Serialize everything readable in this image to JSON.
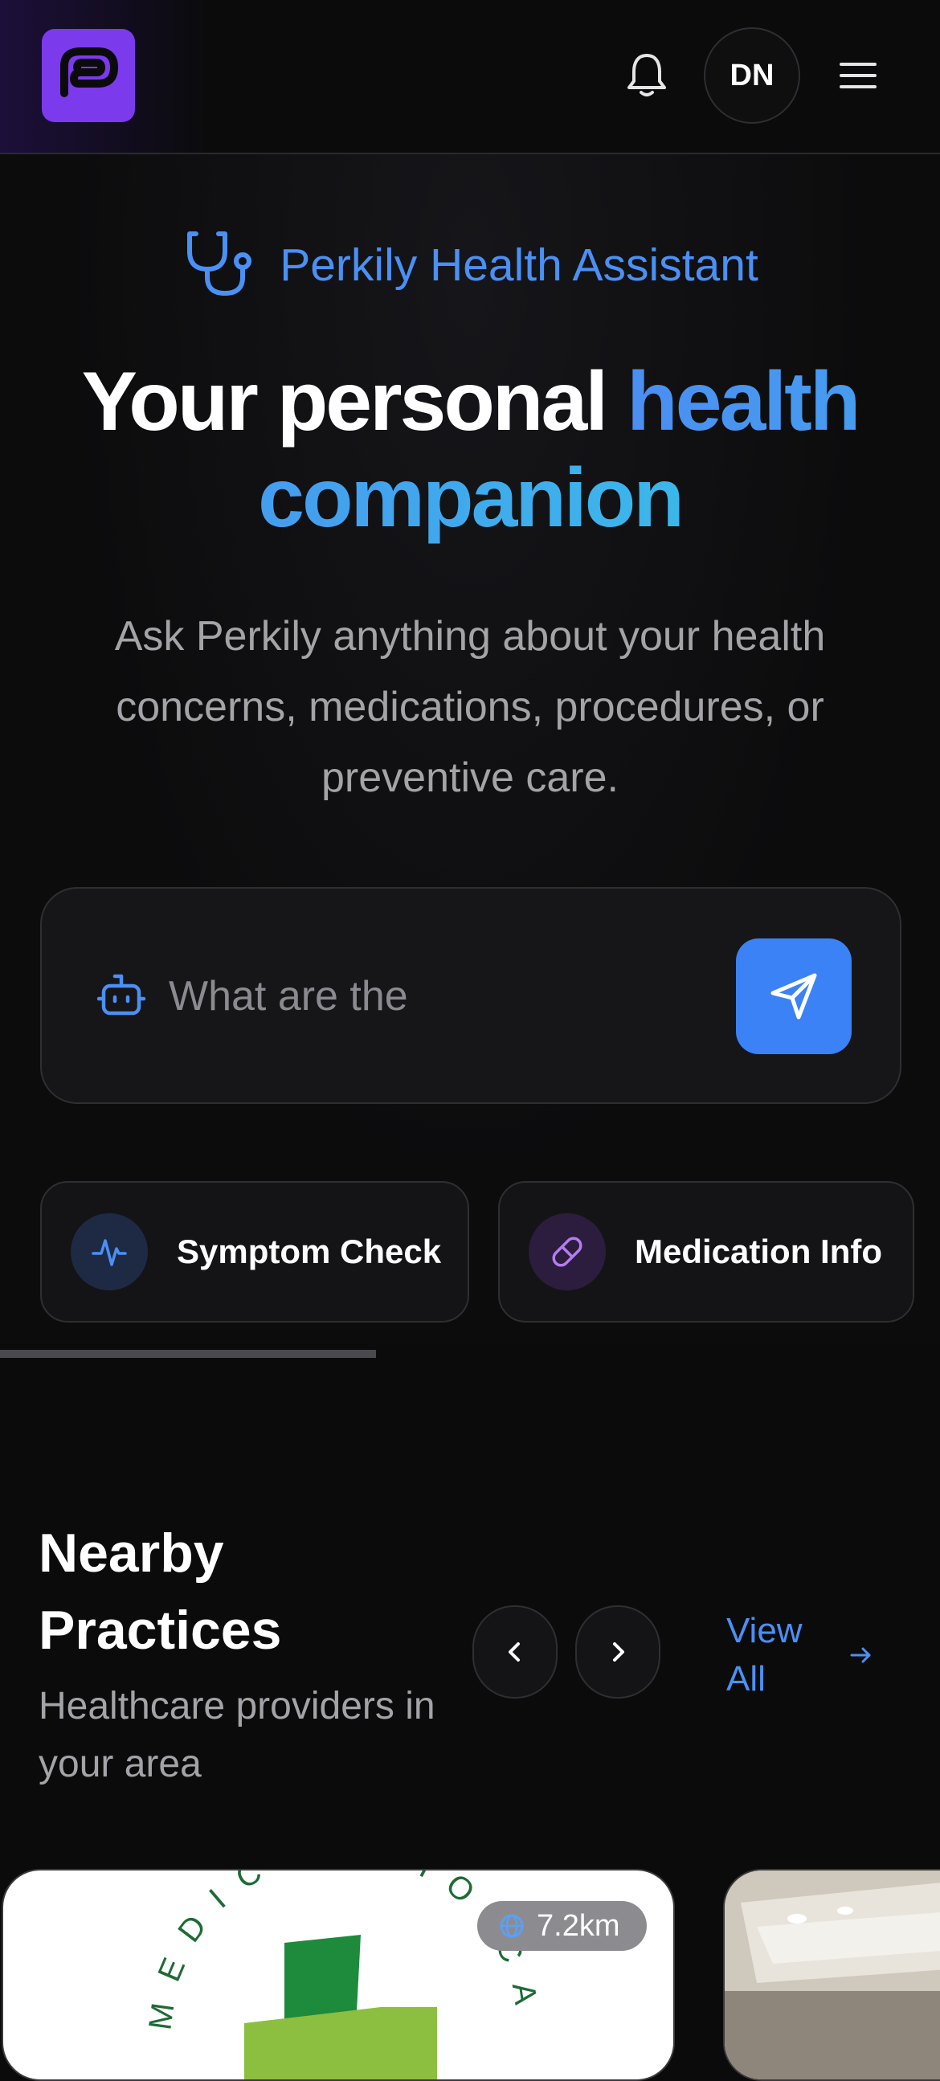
{
  "header": {
    "logo_icon": "perkily-logo-icon",
    "notification_icon": "bell-icon",
    "avatar_initials": "DN",
    "menu_icon": "hamburger-menu-icon"
  },
  "hero": {
    "assistant_icon": "stethoscope-icon",
    "assistant_label": "Perkily Health Assistant",
    "headline_plain": "Your personal ",
    "headline_accent": "health companion",
    "subtitle": "Ask Perkily anything about your health concerns, medications, procedures, or preventive care."
  },
  "search": {
    "icon": "bot-icon",
    "value": "What are the",
    "send_icon": "send-icon"
  },
  "quick_actions": [
    {
      "label": "Symptom Check",
      "icon": "activity-icon"
    },
    {
      "label": "Medication Info",
      "icon": "pill-icon"
    }
  ],
  "nearby": {
    "title": "Nearby Practices",
    "subtitle": "Healthcare providers in your area",
    "prev_icon": "chevron-left-icon",
    "next_icon": "chevron-right-icon",
    "view_all_label": "View All",
    "view_all_icon": "arrow-right-icon",
    "cards": [
      {
        "logo_text": "MEDICS WHO CARE",
        "distance": "7.2km",
        "distance_icon": "globe-icon"
      },
      {
        "image": "clinic-interior-photo"
      }
    ]
  },
  "colors": {
    "background": "#0b0b0c",
    "accent_blue": "#3b82f6",
    "brand_purple": "#7c3aed",
    "link_blue": "#4a90f5"
  }
}
